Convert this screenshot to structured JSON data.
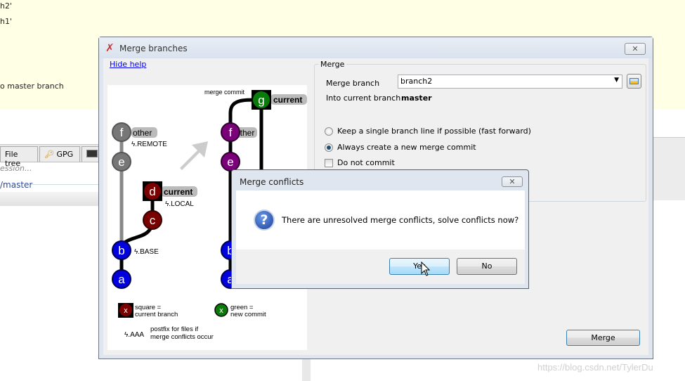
{
  "background": {
    "lines": [
      "h2'",
      "h1'",
      "o master branch"
    ],
    "tabs": [
      {
        "label": "File tree"
      },
      {
        "label": "GPG",
        "icon": "key-icon"
      },
      {
        "icon": "terminal-icon"
      }
    ],
    "commit_placeholder": "ession...",
    "branch_label": "/master"
  },
  "main_dialog": {
    "title": "Merge branches",
    "hide_help": "Hide help",
    "group_title": "Merge",
    "merge_branch_label": "Merge branch",
    "merge_branch_value": "branch2",
    "into_label": "Into current branch",
    "into_value": "master",
    "options": [
      {
        "label": "Keep a single branch line if possible (fast forward)",
        "type": "radio",
        "checked": false
      },
      {
        "label": "Always create a new merge commit",
        "type": "radio",
        "checked": true
      },
      {
        "label": "Do not commit",
        "type": "checkbox",
        "checked": false
      }
    ],
    "merge_button": "Merge"
  },
  "help_diagram": {
    "merge_commit": "merge commit",
    "current": "current",
    "other": "other",
    "remote": "ϟ.REMOTE",
    "local": "ϟ.LOCAL",
    "base": "ϟ.BASE",
    "nodes": [
      "a",
      "b",
      "c",
      "d",
      "e",
      "f",
      "g"
    ],
    "legend_square": [
      "square =",
      "current branch"
    ],
    "legend_green": [
      "green =",
      "new commit"
    ],
    "legend_x": "x",
    "legend_aaa": "ϟ.AAA",
    "legend_postfix": [
      "postfix for files if",
      "merge conflicts occur"
    ],
    "colors": {
      "gray": "#777777",
      "red": "#7a0000",
      "blue": "#0000e0",
      "purple": "#7a007a",
      "green": "#0a7a0a"
    }
  },
  "conflict_dialog": {
    "title": "Merge conflicts",
    "message": "There are unresolved merge conflicts, solve conflicts now?",
    "yes": "Yes",
    "no": "No"
  },
  "watermark": "https://blog.csdn.net/TylerDu"
}
